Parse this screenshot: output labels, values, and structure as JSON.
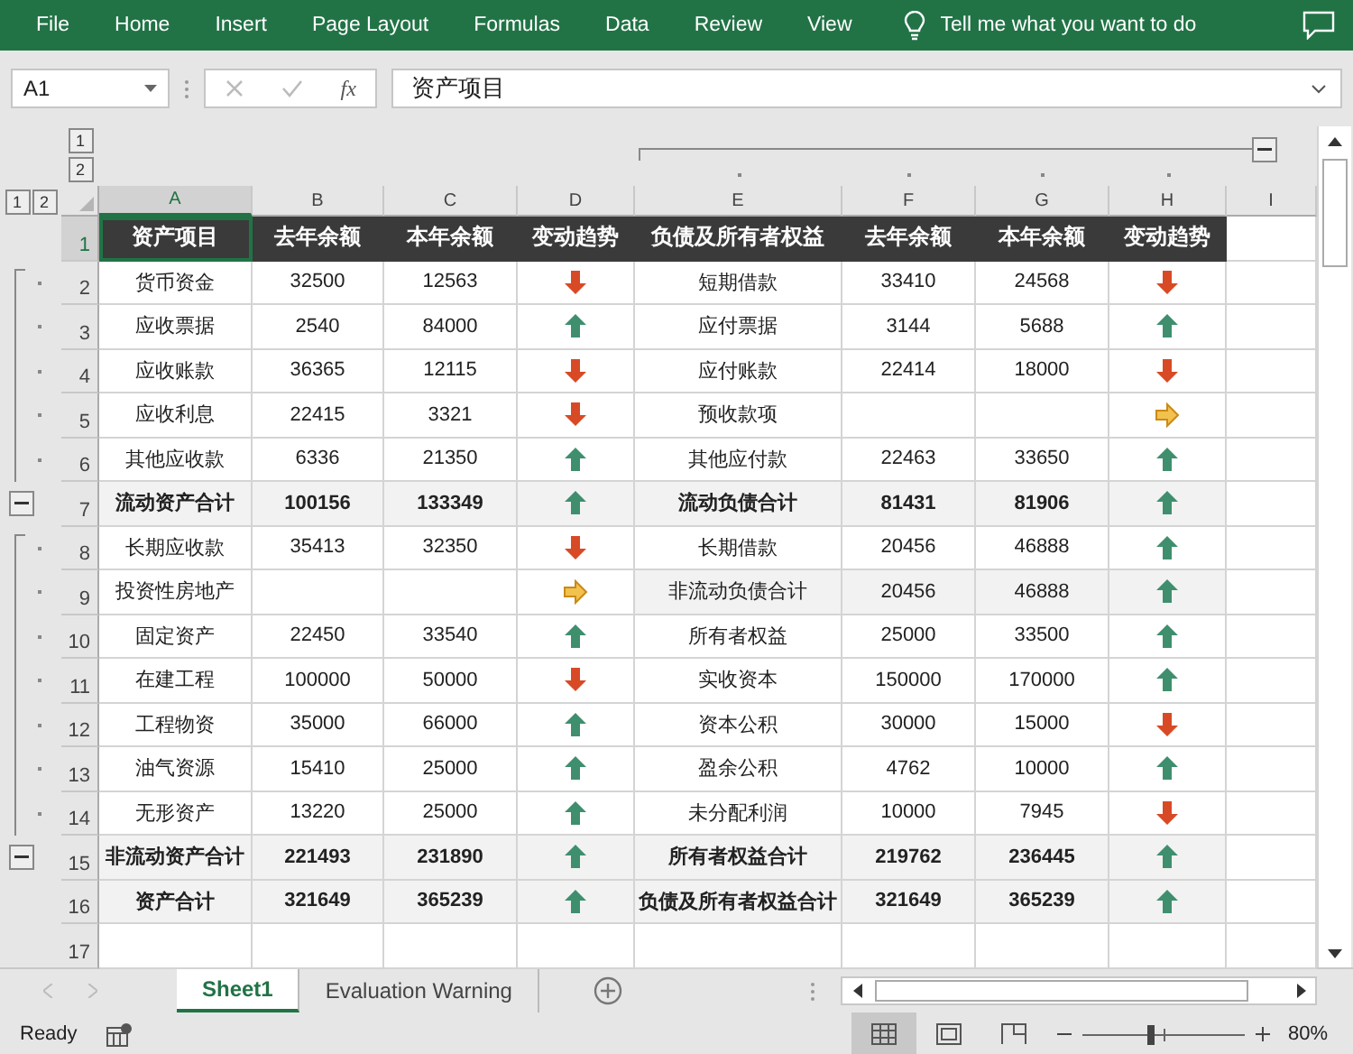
{
  "menu": {
    "items": [
      "File",
      "Home",
      "Insert",
      "Page Layout",
      "Formulas",
      "Data",
      "Review",
      "View"
    ],
    "tell_me": "Tell me what you want to do"
  },
  "formula_bar": {
    "name_box": "A1",
    "fx": "fx",
    "value": "资产项目"
  },
  "outline": {
    "column_levels": [
      "1",
      "2"
    ],
    "row_levels": [
      "1",
      "2"
    ]
  },
  "columns": [
    {
      "label": "A",
      "selected": true
    },
    {
      "label": "B",
      "selected": false
    },
    {
      "label": "C",
      "selected": false
    },
    {
      "label": "D",
      "selected": false
    },
    {
      "label": "E",
      "selected": false
    },
    {
      "label": "F",
      "selected": false
    },
    {
      "label": "G",
      "selected": false
    },
    {
      "label": "H",
      "selected": false
    },
    {
      "label": "I",
      "selected": false
    }
  ],
  "rows": [
    {
      "number": "1",
      "selected": true,
      "left": {
        "kind": "header",
        "name": "资产项目",
        "last": "去年余额",
        "this": "本年余额",
        "trend_label": "变动趋势"
      },
      "right": {
        "kind": "header",
        "name": "负债及所有者权益",
        "last": "去年余额",
        "this": "本年余额",
        "trend_label": "变动趋势"
      }
    },
    {
      "number": "2",
      "selected": false,
      "outline": {
        "kind": "dot"
      },
      "left": {
        "kind": "item",
        "name": "货币资金",
        "last": "32500",
        "this": "12563",
        "trend": {
          "kind": "down"
        }
      },
      "right": {
        "kind": "item",
        "name": "短期借款",
        "last": "33410",
        "this": "24568",
        "trend": {
          "kind": "down"
        }
      }
    },
    {
      "number": "3",
      "selected": false,
      "outline": {
        "kind": "dot"
      },
      "left": {
        "kind": "item",
        "name": "应收票据",
        "last": "2540",
        "this": "84000",
        "trend": {
          "kind": "up"
        }
      },
      "right": {
        "kind": "item",
        "name": "应付票据",
        "last": "3144",
        "this": "5688",
        "trend": {
          "kind": "up"
        }
      }
    },
    {
      "number": "4",
      "selected": false,
      "outline": {
        "kind": "dot"
      },
      "left": {
        "kind": "item",
        "name": "应收账款",
        "last": "36365",
        "this": "12115",
        "trend": {
          "kind": "down"
        }
      },
      "right": {
        "kind": "item",
        "name": "应付账款",
        "last": "22414",
        "this": "18000",
        "trend": {
          "kind": "down"
        }
      }
    },
    {
      "number": "5",
      "selected": false,
      "outline": {
        "kind": "dot"
      },
      "left": {
        "kind": "item",
        "name": "应收利息",
        "last": "22415",
        "this": "3321",
        "trend": {
          "kind": "down"
        }
      },
      "right": {
        "kind": "item",
        "name": "预收款项",
        "trend": {
          "kind": "flat"
        }
      }
    },
    {
      "number": "6",
      "selected": false,
      "outline": {
        "kind": "dot"
      },
      "left": {
        "kind": "item",
        "name": "其他应收款",
        "last": "6336",
        "this": "21350",
        "trend": {
          "kind": "up"
        }
      },
      "right": {
        "kind": "item",
        "name": "其他应付款",
        "last": "22463",
        "this": "33650",
        "trend": {
          "kind": "up"
        }
      }
    },
    {
      "number": "7",
      "selected": false,
      "outline": {
        "kind": "collapse"
      },
      "left": {
        "kind": "total",
        "name": "流动资产合计",
        "last": "100156",
        "this": "133349",
        "trend": {
          "kind": "up"
        }
      },
      "right": {
        "kind": "total",
        "name": "流动负债合计",
        "last": "81431",
        "this": "81906",
        "trend": {
          "kind": "up"
        }
      }
    },
    {
      "number": "8",
      "selected": false,
      "outline": {
        "kind": "dot"
      },
      "left": {
        "kind": "item",
        "name": "长期应收款",
        "last": "35413",
        "this": "32350",
        "trend": {
          "kind": "down"
        }
      },
      "right": {
        "kind": "item",
        "name": "长期借款",
        "last": "20456",
        "this": "46888",
        "trend": {
          "kind": "up"
        }
      }
    },
    {
      "number": "9",
      "selected": false,
      "outline": {
        "kind": "dot"
      },
      "left": {
        "kind": "item",
        "name": "投资性房地产",
        "trend": {
          "kind": "flat"
        }
      },
      "right": {
        "kind": "shaded",
        "name": "非流动负债合计",
        "last": "20456",
        "this": "46888",
        "trend": {
          "kind": "up"
        }
      }
    },
    {
      "number": "10",
      "selected": false,
      "outline": {
        "kind": "dot"
      },
      "left": {
        "kind": "item",
        "name": "固定资产",
        "last": "22450",
        "this": "33540",
        "trend": {
          "kind": "up"
        }
      },
      "right": {
        "kind": "item",
        "name": "所有者权益",
        "last": "25000",
        "this": "33500",
        "trend": {
          "kind": "up"
        }
      }
    },
    {
      "number": "11",
      "selected": false,
      "outline": {
        "kind": "dot"
      },
      "left": {
        "kind": "item",
        "name": "在建工程",
        "last": "100000",
        "this": "50000",
        "trend": {
          "kind": "down"
        }
      },
      "right": {
        "kind": "item",
        "name": "实收资本",
        "last": "150000",
        "this": "170000",
        "trend": {
          "kind": "up"
        }
      }
    },
    {
      "number": "12",
      "selected": false,
      "outline": {
        "kind": "dot"
      },
      "left": {
        "kind": "item",
        "name": "工程物资",
        "last": "35000",
        "this": "66000",
        "trend": {
          "kind": "up"
        }
      },
      "right": {
        "kind": "item",
        "name": "资本公积",
        "last": "30000",
        "this": "15000",
        "trend": {
          "kind": "down"
        }
      }
    },
    {
      "number": "13",
      "selected": false,
      "outline": {
        "kind": "dot"
      },
      "left": {
        "kind": "item",
        "name": "油气资源",
        "last": "15410",
        "this": "25000",
        "trend": {
          "kind": "up"
        }
      },
      "right": {
        "kind": "item",
        "name": "盈余公积",
        "last": "4762",
        "this": "10000",
        "trend": {
          "kind": "up"
        }
      }
    },
    {
      "number": "14",
      "selected": false,
      "outline": {
        "kind": "dot"
      },
      "left": {
        "kind": "item",
        "name": "无形资产",
        "last": "13220",
        "this": "25000",
        "trend": {
          "kind": "up"
        }
      },
      "right": {
        "kind": "item",
        "name": "未分配利润",
        "last": "10000",
        "this": "7945",
        "trend": {
          "kind": "down"
        }
      }
    },
    {
      "number": "15",
      "selected": false,
      "outline": {
        "kind": "collapse"
      },
      "left": {
        "kind": "total",
        "name": "非流动资产合计",
        "last": "221493",
        "this": "231890",
        "trend": {
          "kind": "up"
        }
      },
      "right": {
        "kind": "total",
        "name": "所有者权益合计",
        "last": "219762",
        "this": "236445",
        "trend": {
          "kind": "up"
        }
      }
    },
    {
      "number": "16",
      "selected": false,
      "left": {
        "kind": "total",
        "name": "资产合计",
        "last": "321649",
        "this": "365239",
        "trend": {
          "kind": "up"
        }
      },
      "right": {
        "kind": "total",
        "name": "负债及所有者权益合计",
        "last": "321649",
        "this": "365239",
        "trend": {
          "kind": "up"
        }
      }
    },
    {
      "number": "17",
      "selected": false
    }
  ],
  "sheet_tabs": [
    {
      "label": "Sheet1",
      "selected": true
    },
    {
      "label": "Evaluation Warning",
      "selected": false
    }
  ],
  "status_bar": {
    "status": "Ready",
    "zoom": {
      "level": 0.42,
      "reading": "80%"
    }
  }
}
